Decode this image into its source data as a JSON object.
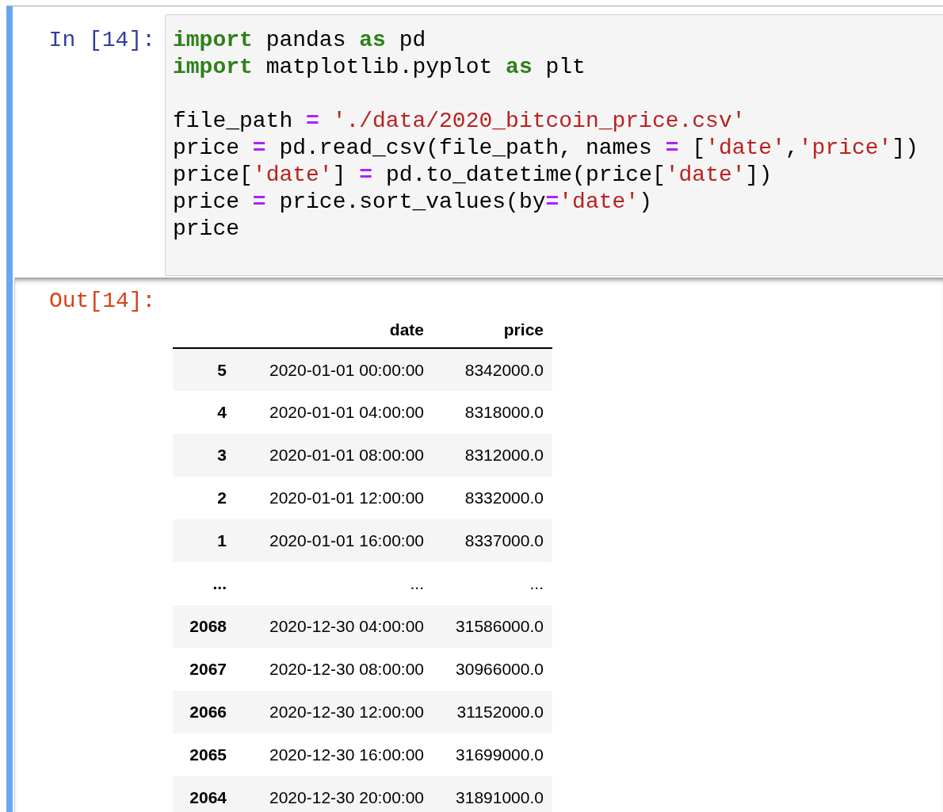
{
  "input_cell": {
    "prompt": "In [14]:",
    "blocks": [
      [
        [
          {
            "kind": "keyword",
            "text": "import"
          },
          {
            "kind": "plain",
            "text": " pandas "
          },
          {
            "kind": "keyword",
            "text": "as"
          },
          {
            "kind": "plain",
            "text": " pd"
          }
        ],
        [
          {
            "kind": "keyword",
            "text": "import"
          },
          {
            "kind": "plain",
            "text": " matplotlib.pyplot "
          },
          {
            "kind": "keyword",
            "text": "as"
          },
          {
            "kind": "plain",
            "text": " plt"
          }
        ]
      ],
      [
        [
          {
            "kind": "plain",
            "text": "file_path "
          },
          {
            "kind": "operator",
            "text": "= "
          },
          {
            "kind": "string",
            "text": "'./data/2020_bitcoin_price.csv'"
          }
        ],
        [
          {
            "kind": "plain",
            "text": "price "
          },
          {
            "kind": "operator",
            "text": "="
          },
          {
            "kind": "plain",
            "text": " pd.read_csv(file_path, names "
          },
          {
            "kind": "operator",
            "text": "="
          },
          {
            "kind": "plain",
            "text": " ["
          },
          {
            "kind": "string",
            "text": "'date'"
          },
          {
            "kind": "plain",
            "text": ","
          },
          {
            "kind": "string",
            "text": "'price'"
          },
          {
            "kind": "plain",
            "text": "])"
          }
        ],
        [
          {
            "kind": "plain",
            "text": "price["
          },
          {
            "kind": "string",
            "text": "'date'"
          },
          {
            "kind": "plain",
            "text": "] "
          },
          {
            "kind": "operator",
            "text": "="
          },
          {
            "kind": "plain",
            "text": " pd.to_datetime(price["
          },
          {
            "kind": "string",
            "text": "'date'"
          },
          {
            "kind": "plain",
            "text": "])"
          }
        ],
        [
          {
            "kind": "plain",
            "text": "price "
          },
          {
            "kind": "operator",
            "text": "="
          },
          {
            "kind": "plain",
            "text": " price.sort_values(by"
          },
          {
            "kind": "operator",
            "text": "="
          },
          {
            "kind": "string",
            "text": "'date'"
          },
          {
            "kind": "plain",
            "text": ")"
          }
        ],
        [
          {
            "kind": "plain",
            "text": "price"
          }
        ]
      ]
    ]
  },
  "output_cell": {
    "prompt": "Out[14]:",
    "table": {
      "columns": [
        "date",
        "price"
      ],
      "rows": [
        {
          "index": "5",
          "cells": [
            "2020-01-01 00:00:00",
            "8342000.0"
          ]
        },
        {
          "index": "4",
          "cells": [
            "2020-01-01 04:00:00",
            "8318000.0"
          ]
        },
        {
          "index": "3",
          "cells": [
            "2020-01-01 08:00:00",
            "8312000.0"
          ]
        },
        {
          "index": "2",
          "cells": [
            "2020-01-01 12:00:00",
            "8332000.0"
          ]
        },
        {
          "index": "1",
          "cells": [
            "2020-01-01 16:00:00",
            "8337000.0"
          ]
        },
        {
          "index": "...",
          "cells": [
            "...",
            "..."
          ]
        },
        {
          "index": "2068",
          "cells": [
            "2020-12-30 04:00:00",
            "31586000.0"
          ]
        },
        {
          "index": "2067",
          "cells": [
            "2020-12-30 08:00:00",
            "30966000.0"
          ]
        },
        {
          "index": "2066",
          "cells": [
            "2020-12-30 12:00:00",
            "31152000.0"
          ]
        },
        {
          "index": "2065",
          "cells": [
            "2020-12-30 16:00:00",
            "31699000.0"
          ]
        },
        {
          "index": "2064",
          "cells": [
            "2020-12-30 20:00:00",
            "31891000.0"
          ]
        }
      ]
    }
  }
}
